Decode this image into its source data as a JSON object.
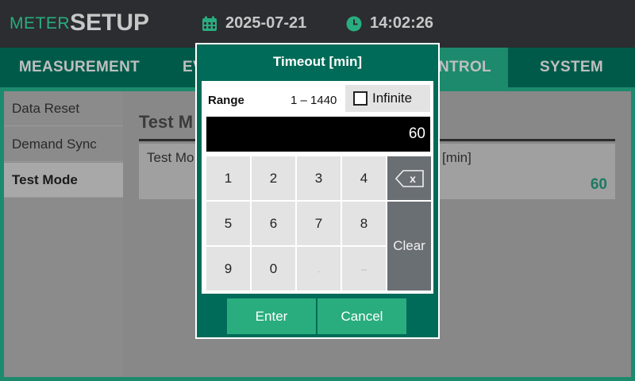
{
  "header": {
    "brand_small": "METER",
    "brand_large": "SETUP",
    "date": "2025-07-21",
    "time": "14:02:26",
    "date_icon": "calendar-icon",
    "time_icon": "clock-icon"
  },
  "tabs": [
    {
      "label": "MEASUREMENT"
    },
    {
      "label": "EV"
    },
    {
      "label": "NTROL"
    },
    {
      "label": "SYSTEM"
    }
  ],
  "sidebar": {
    "items": [
      {
        "label": "Data Reset"
      },
      {
        "label": "Demand Sync"
      },
      {
        "label": "Test Mode"
      }
    ]
  },
  "content": {
    "title": "Test M",
    "setting_label_left": "Test Mo",
    "setting_label_right": "[min]",
    "setting_value": "60"
  },
  "dialog": {
    "title": "Timeout [min]",
    "range_label": "Range",
    "range_value": "1 – 1440",
    "infinite_label": "Infinite",
    "infinite_checked": false,
    "display_value": "60",
    "keys": [
      "1",
      "2",
      "3",
      "4",
      "5",
      "6",
      "7",
      "8",
      "9",
      "0",
      ".",
      "–"
    ],
    "backspace_label": "x",
    "backspace_icon": "backspace-icon",
    "clear_label": "Clear",
    "enter_label": "Enter",
    "cancel_label": "Cancel"
  },
  "colors": {
    "accent": "#2aad7e",
    "header_bg": "#2b2d30",
    "tab_bar_bg": "#005a4a",
    "active_tab_bg": "#1d8a6e",
    "dialog_bg": "#006b58",
    "value_text": "#1d7a62"
  }
}
